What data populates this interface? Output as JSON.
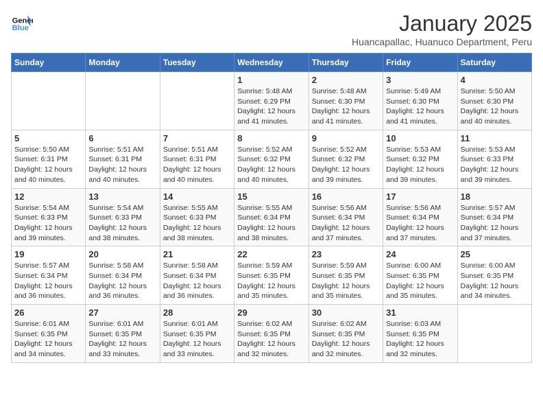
{
  "logo": {
    "line1": "General",
    "line2": "Blue"
  },
  "title": "January 2025",
  "location": "Huancapallac, Huanuco Department, Peru",
  "days_of_week": [
    "Sunday",
    "Monday",
    "Tuesday",
    "Wednesday",
    "Thursday",
    "Friday",
    "Saturday"
  ],
  "weeks": [
    [
      {
        "num": "",
        "info": ""
      },
      {
        "num": "",
        "info": ""
      },
      {
        "num": "",
        "info": ""
      },
      {
        "num": "1",
        "info": "Sunrise: 5:48 AM\nSunset: 6:29 PM\nDaylight: 12 hours\nand 41 minutes."
      },
      {
        "num": "2",
        "info": "Sunrise: 5:48 AM\nSunset: 6:30 PM\nDaylight: 12 hours\nand 41 minutes."
      },
      {
        "num": "3",
        "info": "Sunrise: 5:49 AM\nSunset: 6:30 PM\nDaylight: 12 hours\nand 41 minutes."
      },
      {
        "num": "4",
        "info": "Sunrise: 5:50 AM\nSunset: 6:30 PM\nDaylight: 12 hours\nand 40 minutes."
      }
    ],
    [
      {
        "num": "5",
        "info": "Sunrise: 5:50 AM\nSunset: 6:31 PM\nDaylight: 12 hours\nand 40 minutes."
      },
      {
        "num": "6",
        "info": "Sunrise: 5:51 AM\nSunset: 6:31 PM\nDaylight: 12 hours\nand 40 minutes."
      },
      {
        "num": "7",
        "info": "Sunrise: 5:51 AM\nSunset: 6:31 PM\nDaylight: 12 hours\nand 40 minutes."
      },
      {
        "num": "8",
        "info": "Sunrise: 5:52 AM\nSunset: 6:32 PM\nDaylight: 12 hours\nand 40 minutes."
      },
      {
        "num": "9",
        "info": "Sunrise: 5:52 AM\nSunset: 6:32 PM\nDaylight: 12 hours\nand 39 minutes."
      },
      {
        "num": "10",
        "info": "Sunrise: 5:53 AM\nSunset: 6:32 PM\nDaylight: 12 hours\nand 39 minutes."
      },
      {
        "num": "11",
        "info": "Sunrise: 5:53 AM\nSunset: 6:33 PM\nDaylight: 12 hours\nand 39 minutes."
      }
    ],
    [
      {
        "num": "12",
        "info": "Sunrise: 5:54 AM\nSunset: 6:33 PM\nDaylight: 12 hours\nand 39 minutes."
      },
      {
        "num": "13",
        "info": "Sunrise: 5:54 AM\nSunset: 6:33 PM\nDaylight: 12 hours\nand 38 minutes."
      },
      {
        "num": "14",
        "info": "Sunrise: 5:55 AM\nSunset: 6:33 PM\nDaylight: 12 hours\nand 38 minutes."
      },
      {
        "num": "15",
        "info": "Sunrise: 5:55 AM\nSunset: 6:34 PM\nDaylight: 12 hours\nand 38 minutes."
      },
      {
        "num": "16",
        "info": "Sunrise: 5:56 AM\nSunset: 6:34 PM\nDaylight: 12 hours\nand 37 minutes."
      },
      {
        "num": "17",
        "info": "Sunrise: 5:56 AM\nSunset: 6:34 PM\nDaylight: 12 hours\nand 37 minutes."
      },
      {
        "num": "18",
        "info": "Sunrise: 5:57 AM\nSunset: 6:34 PM\nDaylight: 12 hours\nand 37 minutes."
      }
    ],
    [
      {
        "num": "19",
        "info": "Sunrise: 5:57 AM\nSunset: 6:34 PM\nDaylight: 12 hours\nand 36 minutes."
      },
      {
        "num": "20",
        "info": "Sunrise: 5:58 AM\nSunset: 6:34 PM\nDaylight: 12 hours\nand 36 minutes."
      },
      {
        "num": "21",
        "info": "Sunrise: 5:58 AM\nSunset: 6:34 PM\nDaylight: 12 hours\nand 36 minutes."
      },
      {
        "num": "22",
        "info": "Sunrise: 5:59 AM\nSunset: 6:35 PM\nDaylight: 12 hours\nand 35 minutes."
      },
      {
        "num": "23",
        "info": "Sunrise: 5:59 AM\nSunset: 6:35 PM\nDaylight: 12 hours\nand 35 minutes."
      },
      {
        "num": "24",
        "info": "Sunrise: 6:00 AM\nSunset: 6:35 PM\nDaylight: 12 hours\nand 35 minutes."
      },
      {
        "num": "25",
        "info": "Sunrise: 6:00 AM\nSunset: 6:35 PM\nDaylight: 12 hours\nand 34 minutes."
      }
    ],
    [
      {
        "num": "26",
        "info": "Sunrise: 6:01 AM\nSunset: 6:35 PM\nDaylight: 12 hours\nand 34 minutes."
      },
      {
        "num": "27",
        "info": "Sunrise: 6:01 AM\nSunset: 6:35 PM\nDaylight: 12 hours\nand 33 minutes."
      },
      {
        "num": "28",
        "info": "Sunrise: 6:01 AM\nSunset: 6:35 PM\nDaylight: 12 hours\nand 33 minutes."
      },
      {
        "num": "29",
        "info": "Sunrise: 6:02 AM\nSunset: 6:35 PM\nDaylight: 12 hours\nand 32 minutes."
      },
      {
        "num": "30",
        "info": "Sunrise: 6:02 AM\nSunset: 6:35 PM\nDaylight: 12 hours\nand 32 minutes."
      },
      {
        "num": "31",
        "info": "Sunrise: 6:03 AM\nSunset: 6:35 PM\nDaylight: 12 hours\nand 32 minutes."
      },
      {
        "num": "",
        "info": ""
      }
    ]
  ]
}
